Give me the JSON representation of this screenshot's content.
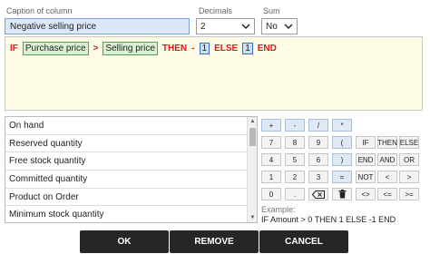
{
  "caption": {
    "label": "Caption of column",
    "value": "Negative selling price"
  },
  "decimals": {
    "label": "Decimals",
    "value": "2"
  },
  "sum": {
    "label": "Sum",
    "value": "No"
  },
  "formula": {
    "if": "IF",
    "field1": "Purchase price",
    "gt": ">",
    "field2": "Selling price",
    "then": "THEN",
    "minus": "-",
    "num1": "1",
    "else": "ELSE",
    "num2": "1",
    "end": "END"
  },
  "fields": [
    "On hand",
    "Reserved quantity",
    "Free stock quantity",
    "Committed quantity",
    "Product on Order",
    "Minimum stock quantity"
  ],
  "keypad": {
    "row1": [
      "+",
      "-",
      "/",
      "*"
    ],
    "row2": [
      "7",
      "8",
      "9",
      "(",
      "IF",
      "THEN",
      "ELSE"
    ],
    "row3": [
      "4",
      "5",
      "6",
      ")",
      "END",
      "AND",
      "OR"
    ],
    "row4": [
      "1",
      "2",
      "3",
      "=",
      "NOT",
      "<",
      ">"
    ],
    "row5": [
      "0",
      ".",
      "<>",
      "<=",
      ">="
    ],
    "backspace_icon": "backspace-icon",
    "trash_icon": "trash-icon"
  },
  "example": {
    "label": "Example:",
    "text": "IF Amount > 0 THEN 1 ELSE -1 END"
  },
  "buttons": {
    "ok": "OK",
    "remove": "REMOVE",
    "cancel": "CANCEL"
  }
}
